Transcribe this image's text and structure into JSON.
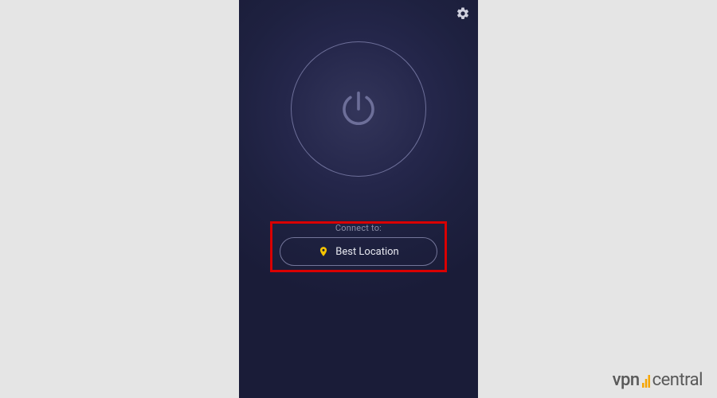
{
  "connect_label": "Connect to:",
  "location": {
    "name": "Best Location"
  },
  "icons": {
    "settings": "gear-icon",
    "power": "power-icon",
    "pin": "location-pin-icon"
  },
  "colors": {
    "accent_yellow": "#f5c400",
    "highlight_red": "#d90000",
    "text_muted": "#8a8ca5",
    "text_light": "#e8e9f1",
    "outline": "#6d6f99"
  },
  "watermark": {
    "part1": "vpn",
    "part2": "central"
  }
}
